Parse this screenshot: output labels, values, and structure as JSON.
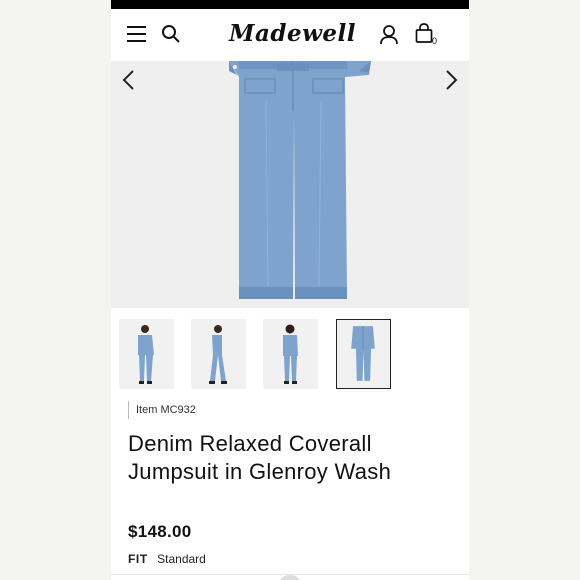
{
  "header": {
    "brand": "Madewell",
    "bag_count": "0"
  },
  "product": {
    "item_number": "Item MC932",
    "title_line1": "Denim Relaxed Coverall",
    "title_line2": "Jumpsuit in Glenroy Wash",
    "price": "$148.00",
    "fit_label": "FIT",
    "fit_value": "Standard"
  },
  "gallery": {
    "thumbnail_count": 4,
    "selected_thumbnail": 4
  },
  "colors": {
    "denim": "#7ea3cc",
    "denim_dark": "#5f86b3",
    "text": "#111111"
  },
  "icons": [
    "menu-icon",
    "search-icon",
    "account-icon",
    "shopping-bag-icon",
    "chevron-left-icon",
    "chevron-right-icon"
  ]
}
